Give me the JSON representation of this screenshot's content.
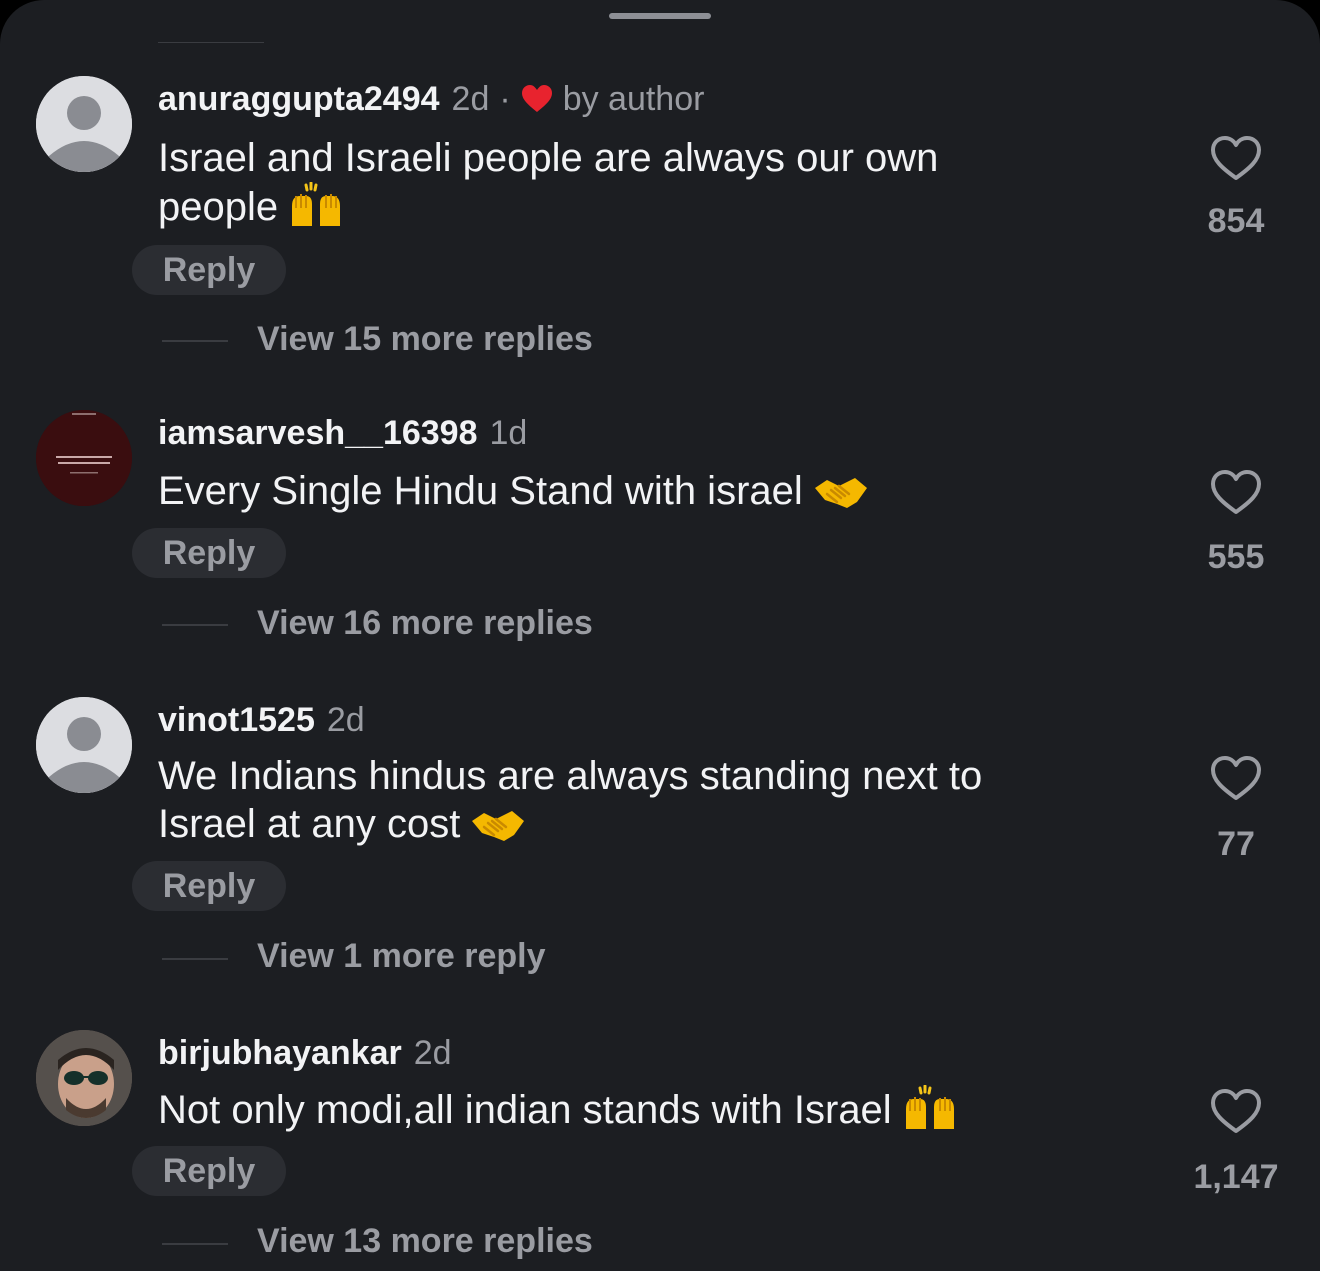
{
  "colors": {
    "sheet_bg": "#1c1e22",
    "primary_text": "#f2f3f5",
    "secondary_text": "#9a9ca2",
    "reply_bg": "#2b2d32",
    "author_heart": "#e8232e"
  },
  "comments": [
    {
      "username": "anuraggupta2494",
      "time": "2d",
      "separator": "·",
      "author_label": "by author",
      "text_line1": "Israel and Israeli people are always our own",
      "text_line2": "people",
      "emoji": "🙌",
      "reply_label": "Reply",
      "more_replies": "View 15 more replies",
      "likes": "854",
      "avatar": "default-avatar-icon"
    },
    {
      "username": "iamsarvesh__16398",
      "time": "1d",
      "text_line1": "Every Single Hindu Stand with israel",
      "emoji": "🤝",
      "reply_label": "Reply",
      "more_replies": "View 16 more replies",
      "likes": "555",
      "avatar": "quote-image-avatar"
    },
    {
      "username": "vinot1525",
      "time": "2d",
      "text_line1": "We Indians hindus are always standing next to",
      "text_line2": "Israel at any cost",
      "emoji": "🤝",
      "reply_label": "Reply",
      "more_replies": "View 1 more reply",
      "likes": "77",
      "avatar": "default-avatar-icon"
    },
    {
      "username": "birjubhayankar",
      "time": "2d",
      "text_line1": "Not only modi,all indian stands with Israel",
      "emoji": "🙌",
      "reply_label": "Reply",
      "more_replies": "View 13 more replies",
      "likes": "1,147",
      "avatar": "photo-avatar"
    }
  ]
}
